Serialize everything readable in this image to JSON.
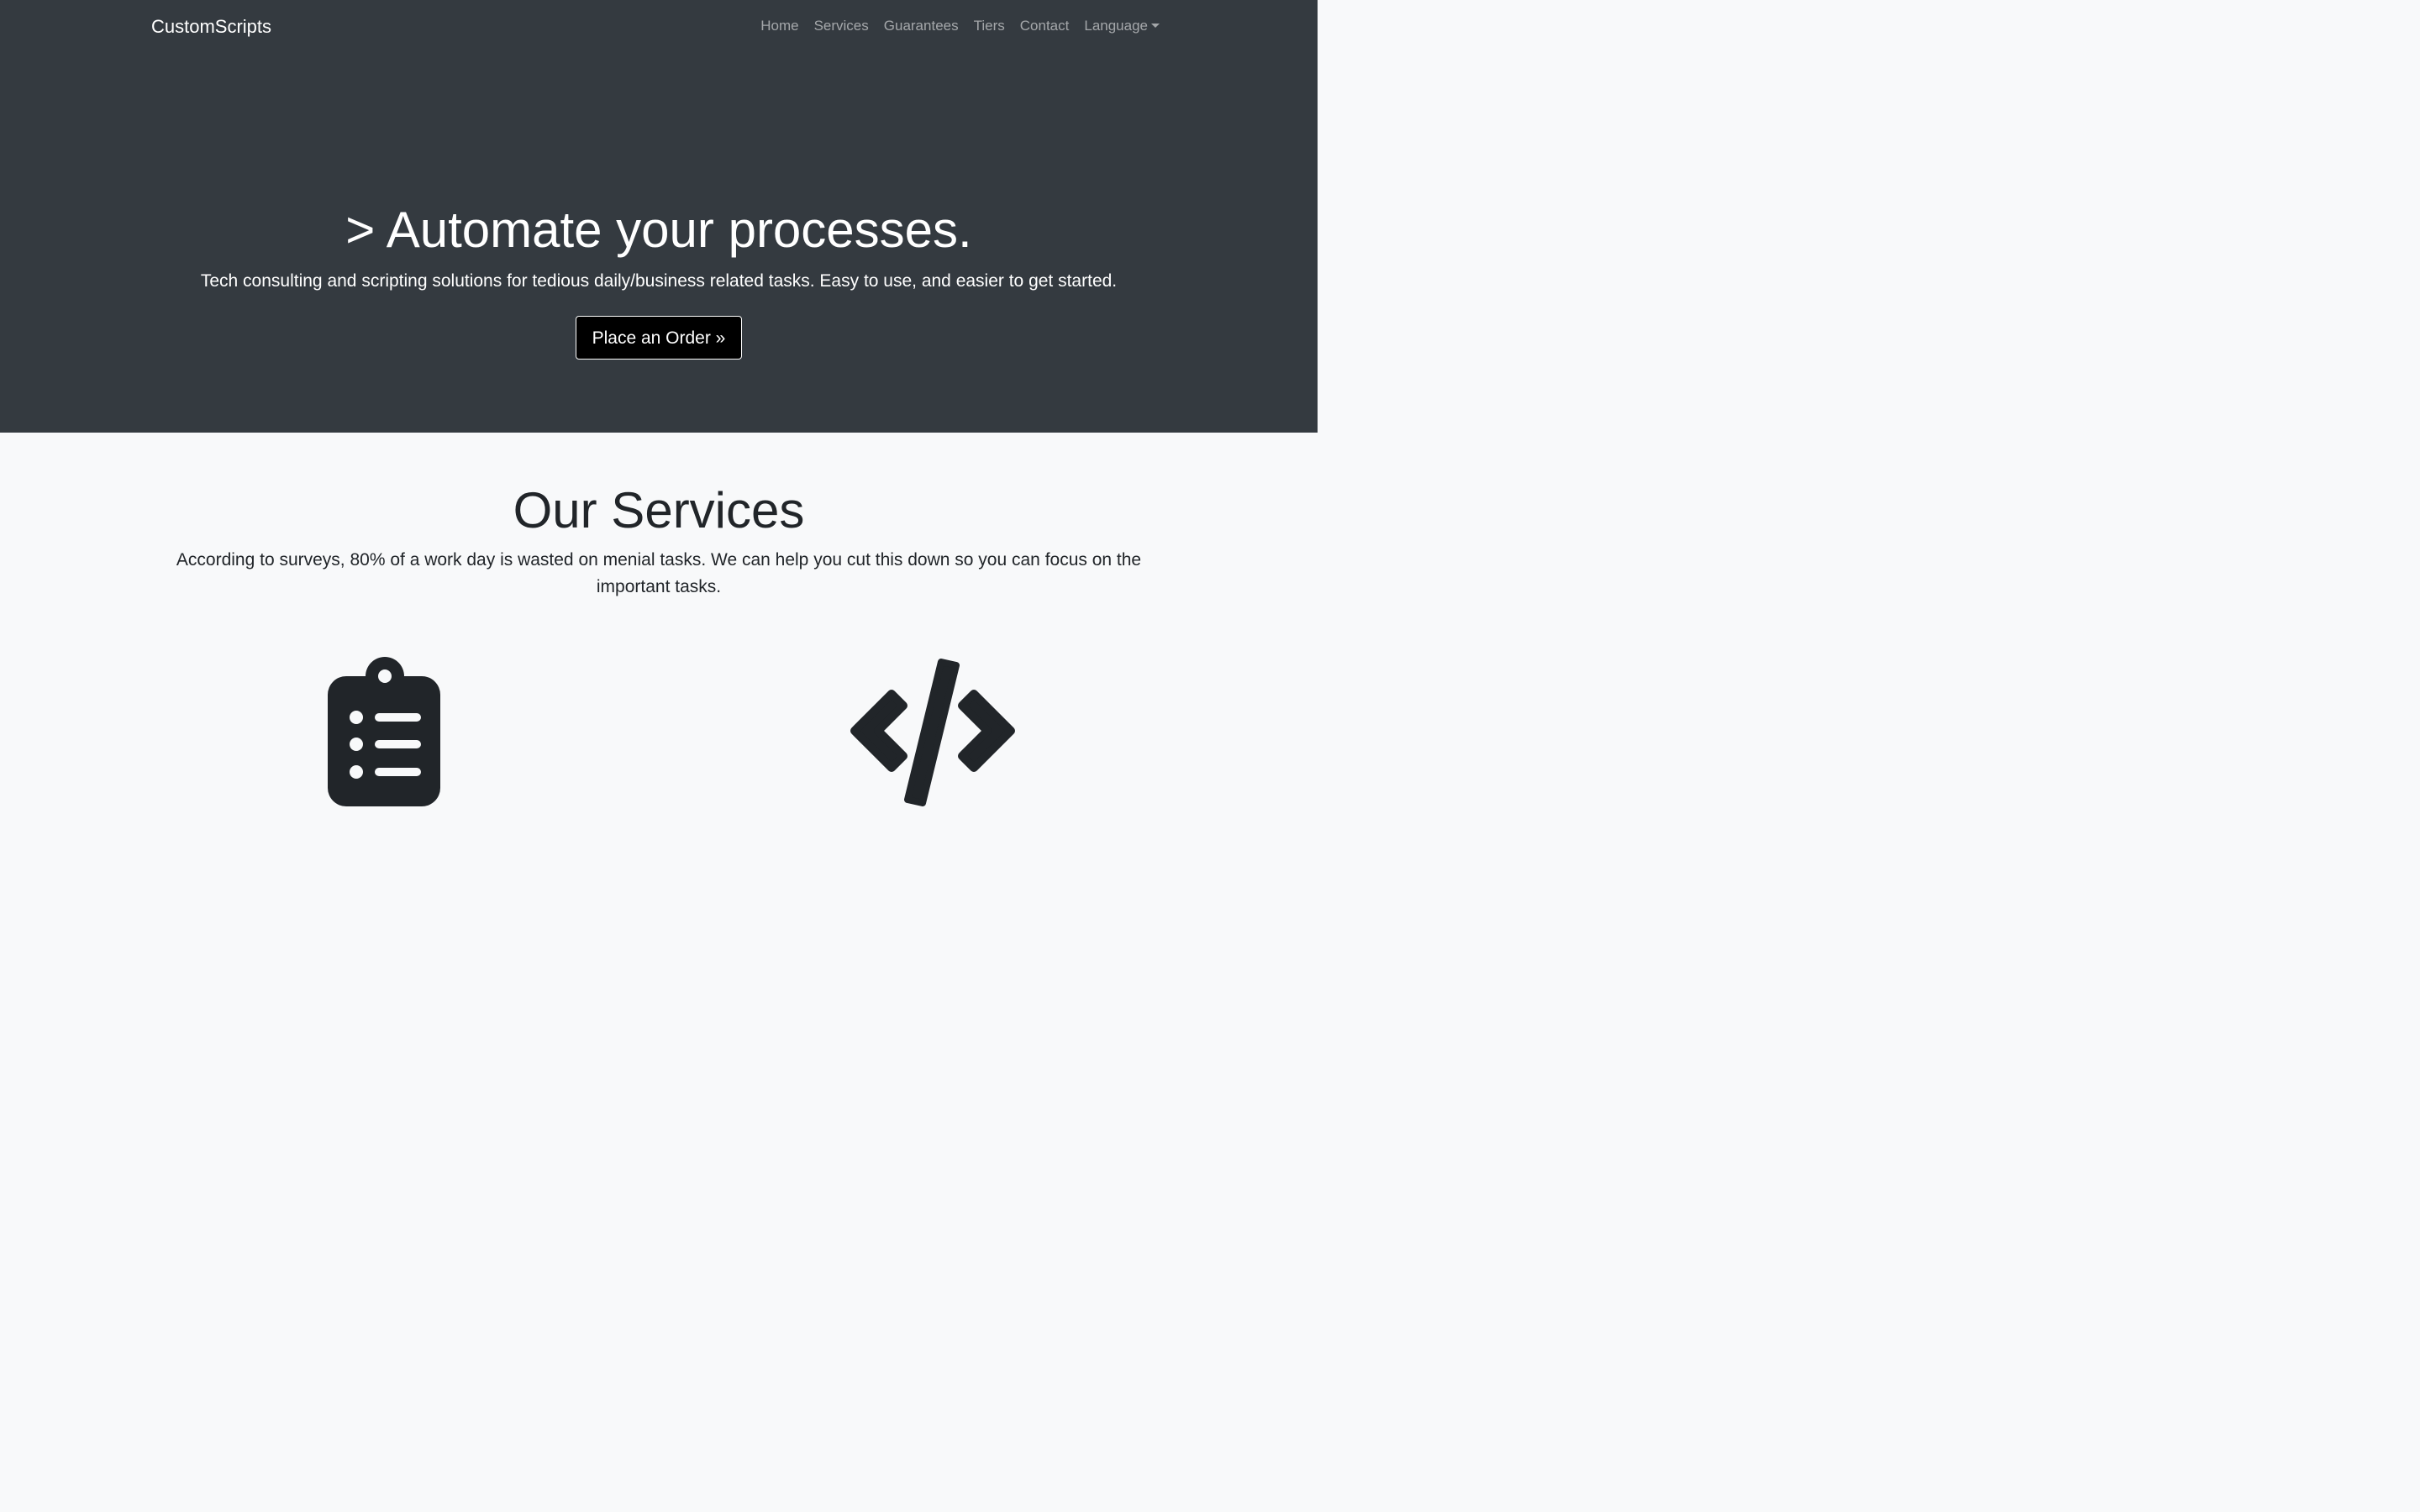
{
  "navbar": {
    "brand": "CustomScripts",
    "links": [
      "Home",
      "Services",
      "Guarantees",
      "Tiers",
      "Contact"
    ],
    "language": "Language"
  },
  "hero": {
    "title": "> Automate your processes.",
    "subtitle": "Tech consulting and scripting solutions for tedious daily/business related tasks. Easy to use, and easier to get started.",
    "button": "Place an Order »"
  },
  "services": {
    "title": "Our Services",
    "subtitle": "According to surveys, 80% of a work day is wasted on menial tasks. We can help you cut this down so you can focus on the important tasks.",
    "icons": [
      "clipboard-list-icon",
      "code-icon"
    ]
  },
  "colors": {
    "hero_bg": "#343a40",
    "page_bg": "#f8f9fa",
    "text_dark": "#212529",
    "button_bg": "#000000"
  }
}
